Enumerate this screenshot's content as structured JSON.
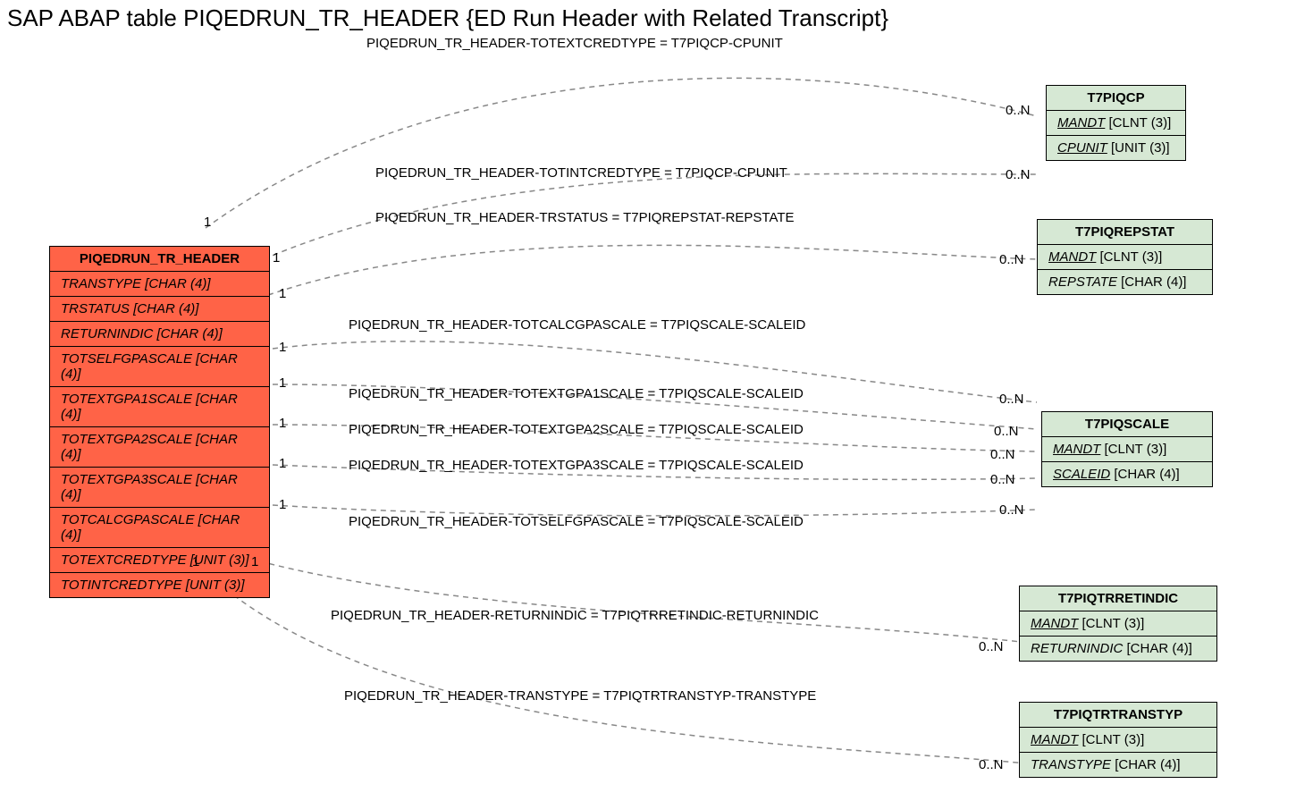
{
  "title": "SAP ABAP table PIQEDRUN_TR_HEADER {ED Run Header with Related Transcript}",
  "main": {
    "name": "PIQEDRUN_TR_HEADER",
    "fields": [
      "TRANSTYPE [CHAR (4)]",
      "TRSTATUS [CHAR (4)]",
      "RETURNINDIC [CHAR (4)]",
      "TOTSELFGPASCALE [CHAR (4)]",
      "TOTEXTGPA1SCALE [CHAR (4)]",
      "TOTEXTGPA2SCALE [CHAR (4)]",
      "TOTEXTGPA3SCALE [CHAR (4)]",
      "TOTCALCGPASCALE [CHAR (4)]",
      "TOTEXTCREDTYPE [UNIT (3)]",
      "TOTINTCREDTYPE [UNIT (3)]"
    ]
  },
  "refs": [
    {
      "name": "T7PIQCP",
      "fields": [
        [
          "MANDT",
          "[CLNT (3)]",
          true
        ],
        [
          "CPUNIT",
          "[UNIT (3)]",
          true
        ]
      ]
    },
    {
      "name": "T7PIQREPSTAT",
      "fields": [
        [
          "MANDT",
          "[CLNT (3)]",
          true
        ],
        [
          "REPSTATE",
          "[CHAR (4)]",
          false
        ]
      ]
    },
    {
      "name": "T7PIQSCALE",
      "fields": [
        [
          "MANDT",
          "[CLNT (3)]",
          true
        ],
        [
          "SCALEID",
          "[CHAR (4)]",
          true
        ]
      ]
    },
    {
      "name": "T7PIQTRRETINDIC",
      "fields": [
        [
          "MANDT",
          "[CLNT (3)]",
          true
        ],
        [
          "RETURNINDIC",
          "[CHAR (4)]",
          false
        ]
      ]
    },
    {
      "name": "T7PIQTRTRANSTYP",
      "fields": [
        [
          "MANDT",
          "[CLNT (3)]",
          true
        ],
        [
          "TRANSTYPE",
          "[CHAR (4)]",
          false
        ]
      ]
    }
  ],
  "rels": [
    "PIQEDRUN_TR_HEADER-TOTEXTCREDTYPE = T7PIQCP-CPUNIT",
    "PIQEDRUN_TR_HEADER-TOTINTCREDTYPE = T7PIQCP-CPUNIT",
    "PIQEDRUN_TR_HEADER-TRSTATUS = T7PIQREPSTAT-REPSTATE",
    "PIQEDRUN_TR_HEADER-TOTCALCGPASCALE = T7PIQSCALE-SCALEID",
    "PIQEDRUN_TR_HEADER-TOTEXTGPA1SCALE = T7PIQSCALE-SCALEID",
    "PIQEDRUN_TR_HEADER-TOTEXTGPA2SCALE = T7PIQSCALE-SCALEID",
    "PIQEDRUN_TR_HEADER-TOTEXTGPA3SCALE = T7PIQSCALE-SCALEID",
    "PIQEDRUN_TR_HEADER-TOTSELFGPASCALE = T7PIQSCALE-SCALEID",
    "PIQEDRUN_TR_HEADER-RETURNINDIC = T7PIQTRRETINDIC-RETURNINDIC",
    "PIQEDRUN_TR_HEADER-TRANSTYPE = T7PIQTRTRANSTYP-TRANSTYPE"
  ],
  "card_left": "1",
  "card_right": "0..N"
}
